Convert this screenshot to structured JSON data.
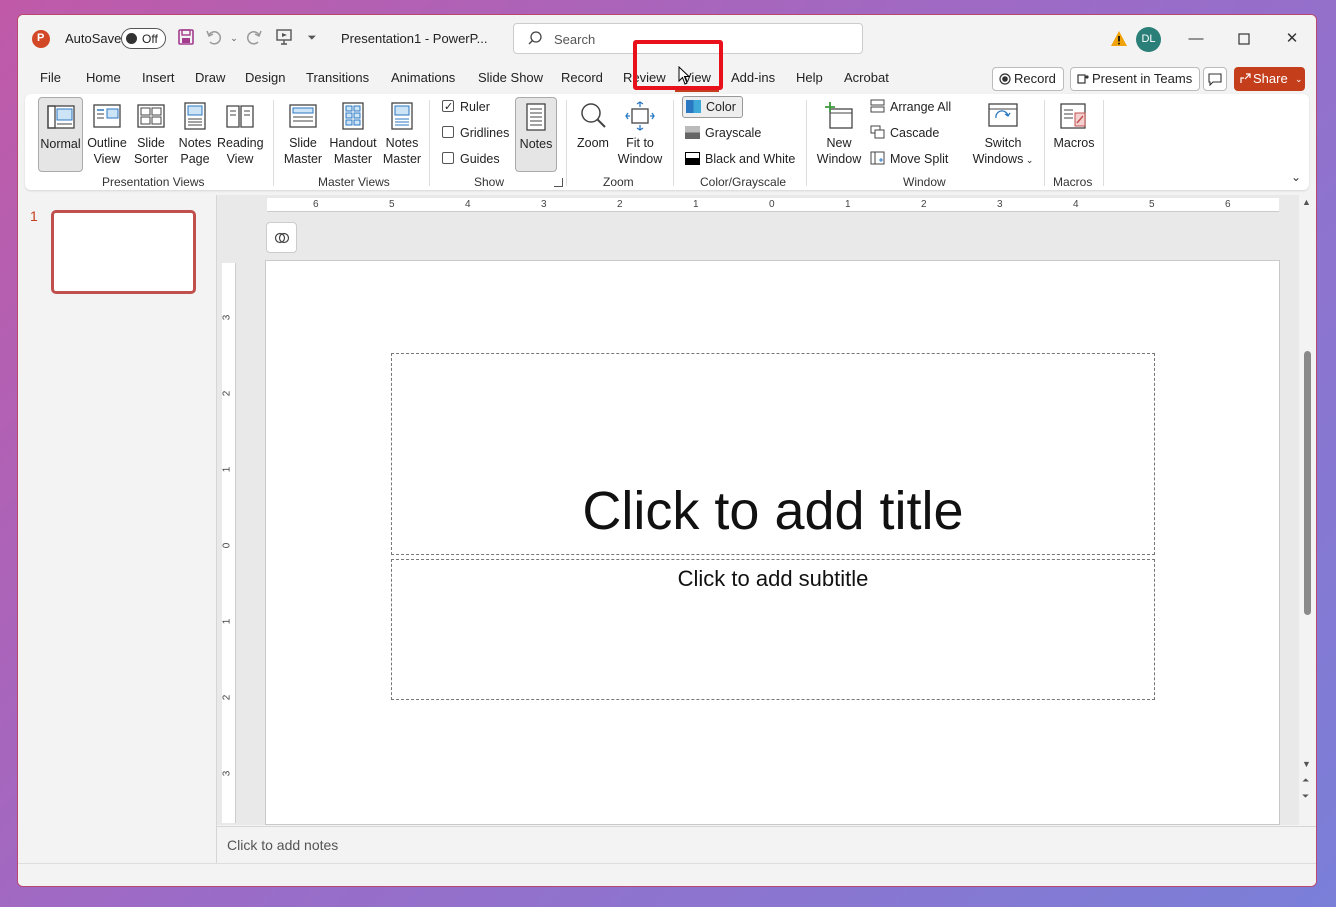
{
  "titlebar": {
    "autosave_label": "AutoSave",
    "autosave_state": "Off",
    "doc_title": "Presentation1  -  PowerP...",
    "search_placeholder": "Search",
    "avatar_initials": "DL"
  },
  "menu": {
    "tabs": [
      "File",
      "Home",
      "Insert",
      "Draw",
      "Design",
      "Transitions",
      "Animations",
      "Slide Show",
      "Record",
      "Review",
      "View",
      "Add-ins",
      "Help",
      "Acrobat"
    ],
    "active_tab": "View",
    "record_label": "Record",
    "present_label": "Present in Teams",
    "share_label": "Share"
  },
  "ribbon": {
    "presentation_views": {
      "label": "Presentation Views",
      "normal": "Normal",
      "outline": [
        "Outline",
        "View"
      ],
      "sorter": [
        "Slide",
        "Sorter"
      ],
      "notes_page": [
        "Notes",
        "Page"
      ],
      "reading": [
        "Reading",
        "View"
      ]
    },
    "master_views": {
      "label": "Master Views",
      "slide": [
        "Slide",
        "Master"
      ],
      "handout": [
        "Handout",
        "Master"
      ],
      "notes": [
        "Notes",
        "Master"
      ]
    },
    "show": {
      "label": "Show",
      "ruler": "Ruler",
      "gridlines": "Gridlines",
      "guides": "Guides",
      "notes": "Notes"
    },
    "zoom": {
      "label": "Zoom",
      "zoom": "Zoom",
      "fit": [
        "Fit to",
        "Window"
      ]
    },
    "color_grayscale": {
      "label": "Color/Grayscale",
      "color": "Color",
      "grayscale": "Grayscale",
      "bw": "Black and White"
    },
    "window": {
      "label": "Window",
      "new_window": [
        "New",
        "Window"
      ],
      "arrange_all": "Arrange All",
      "cascade": "Cascade",
      "move_split": "Move Split",
      "switch": [
        "Switch",
        "Windows"
      ]
    },
    "macros": {
      "label": "Macros",
      "macros": "Macros"
    }
  },
  "slides_panel": {
    "slide_number": "1"
  },
  "ruler": {
    "h_ticks": [
      "6",
      "5",
      "4",
      "3",
      "2",
      "1",
      "0",
      "1",
      "2",
      "3",
      "4",
      "5",
      "6"
    ],
    "v_ticks": [
      "3",
      "2",
      "1",
      "0",
      "1",
      "2",
      "3"
    ]
  },
  "slide": {
    "title_placeholder": "Click to add title",
    "subtitle_placeholder": "Click to add subtitle"
  },
  "notes": {
    "placeholder": "Click to add notes"
  },
  "colors": {
    "accent": "#c43e1c",
    "highlight": "#e8101a"
  }
}
